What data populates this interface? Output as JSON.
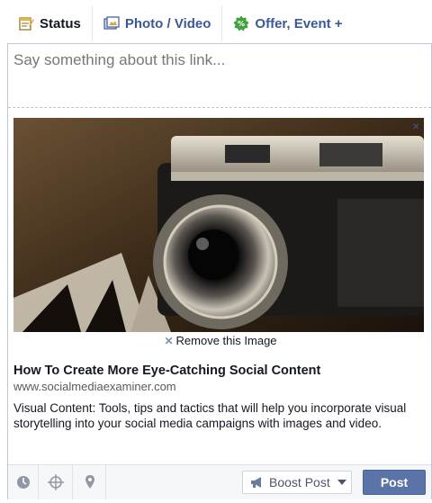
{
  "tabs": [
    {
      "label": "Status",
      "icon": "status-icon"
    },
    {
      "label": "Photo / Video",
      "icon": "photo-icon"
    },
    {
      "label": "Offer, Event +",
      "icon": "offer-icon"
    }
  ],
  "composer": {
    "placeholder": "Say something about this link..."
  },
  "preview": {
    "image": "camera-photo",
    "close_label": "×",
    "remove_label": "Remove this Image",
    "title": "How To Create More Eye-Catching Social Content",
    "url": "www.socialmediaexaminer.com",
    "description": "Visual Content: Tools, tips and tactics that will help you incorporate visual storytelling into your social media campaigns with images and video."
  },
  "footer": {
    "icons": [
      "clock-icon",
      "target-icon",
      "location-pin-icon"
    ],
    "boost_label": "Boost Post",
    "post_label": "Post"
  },
  "colors": {
    "link": "#3b5998",
    "post_button": "#5b74a8"
  }
}
